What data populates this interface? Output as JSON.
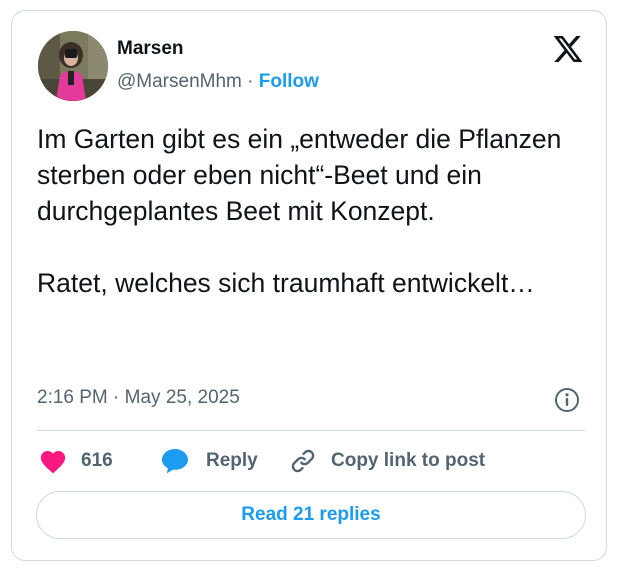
{
  "author": {
    "name": "Marsen",
    "handle": "@MarsenMhm",
    "separator": "·",
    "follow_label": "Follow"
  },
  "platform_icon": "x-logo-icon",
  "tweet": {
    "text": "Im Garten gibt es ein „entweder die Pflanzen sterben oder eben nicht“-Beet und ein durchgeplantes Beet mit Konzept.\n\nRatet, welches sich traumhaft entwickelt…",
    "time": "2:16 PM",
    "date_separator": "·",
    "date": "May 25, 2025"
  },
  "actions": {
    "like_count": "616",
    "reply_label": "Reply",
    "copy_label": "Copy link to post"
  },
  "read_replies_label": "Read 21 replies",
  "colors": {
    "accent": "#1d9bf0",
    "like": "#f91880",
    "text": "#0f1419",
    "muted": "#536471",
    "border": "#cfd9de"
  },
  "icons": [
    "x-logo-icon",
    "info-icon",
    "heart-icon",
    "reply-bubble-icon",
    "link-icon"
  ]
}
